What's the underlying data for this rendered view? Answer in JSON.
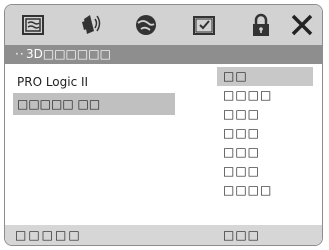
{
  "toolbar": {
    "icons": [
      "display-settings-icon",
      "audio-speaker-icon",
      "general-settings-icon",
      "preferences-icon",
      "lock-icon",
      "close-icon"
    ]
  },
  "title_bar": {
    "dots": "··",
    "text": "3D□□□□□□"
  },
  "left_menu": {
    "items": [
      {
        "label": "PRO Logic II"
      },
      {
        "label": "□□□□□  □□"
      }
    ]
  },
  "right_menu": {
    "items": [
      {
        "label": "□□"
      },
      {
        "label": "□□□□"
      },
      {
        "label": "□□□"
      },
      {
        "label": "□□□"
      },
      {
        "label": "□□□"
      },
      {
        "label": "□□□"
      },
      {
        "label": "□□□□"
      }
    ]
  },
  "footer": {
    "left_label": "□□□□□",
    "right_label": "□□□"
  },
  "colors": {
    "toolbar_bg": "#d2d2d2",
    "title_bar_bg": "#8e8e8e",
    "selection_bg": "#c0c0c0",
    "footer_bg": "#d6d6d6"
  }
}
